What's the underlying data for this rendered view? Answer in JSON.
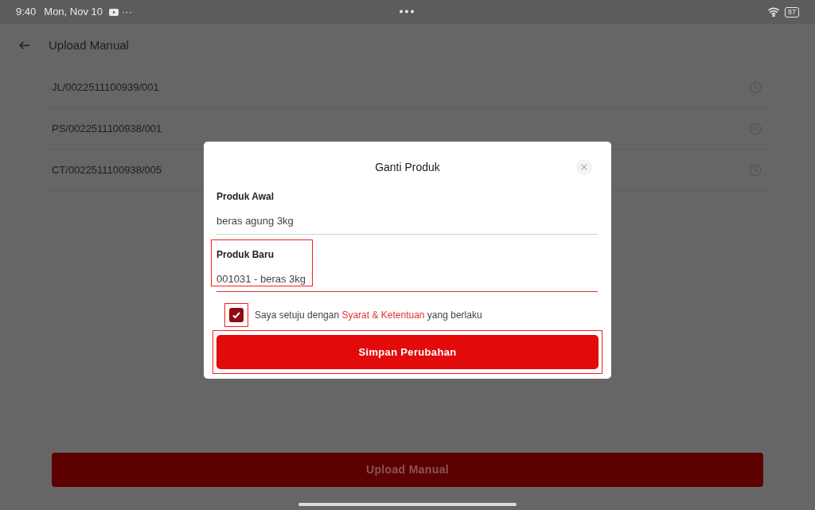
{
  "status_bar": {
    "time": "9:40",
    "date": "Mon, Nov 10",
    "more": "···",
    "battery": "87"
  },
  "header": {
    "title": "Upload Manual"
  },
  "list": [
    {
      "code": "JL/0022511100939/001"
    },
    {
      "code": "PS/0022511100938/001"
    },
    {
      "code": "CT/0022511100938/005"
    }
  ],
  "upload_button": "Upload Manual",
  "dialog": {
    "title": "Ganti Produk",
    "fields": [
      {
        "label": "Produk Awal",
        "value": "beras agung 3kg",
        "highlighted": false,
        "active": false
      },
      {
        "label": "Produk Baru",
        "value": "001031 - beras 3kg",
        "highlighted": true,
        "active": true
      }
    ],
    "agreement": {
      "checked": true,
      "highlighted": true,
      "before": "Saya setuju dengan",
      "link": "Syarat & Ketentuan",
      "after": "yang berlaku"
    },
    "save_button": {
      "label": "Simpan Perubahan",
      "highlighted": true
    }
  }
}
